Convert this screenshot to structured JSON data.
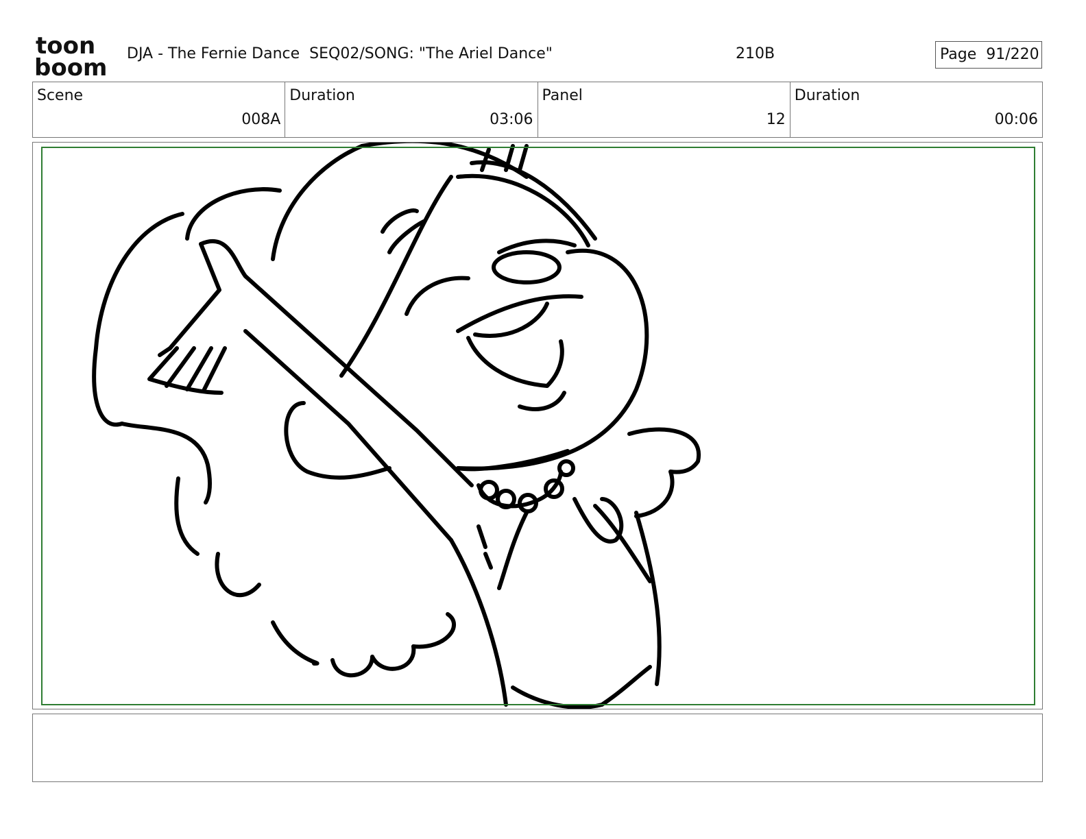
{
  "header": {
    "title": "DJA - The Fernie Dance  SEQ02/SONG: \"The Ariel Dance\"",
    "code": "210B",
    "page": "Page  91/220",
    "logo_line1": "toon",
    "logo_line2": "boom"
  },
  "info": {
    "scene_label": "Scene",
    "scene_value": "008A",
    "scene_duration_label": "Duration",
    "scene_duration_value": "03:06",
    "panel_label": "Panel",
    "panel_value": "12",
    "panel_duration_label": "Duration",
    "panel_duration_value": "00:06"
  },
  "colors": {
    "safe_frame": "#2e7d32",
    "ink": "#000000"
  },
  "icons": {
    "logo": "toon-boom-logo"
  }
}
